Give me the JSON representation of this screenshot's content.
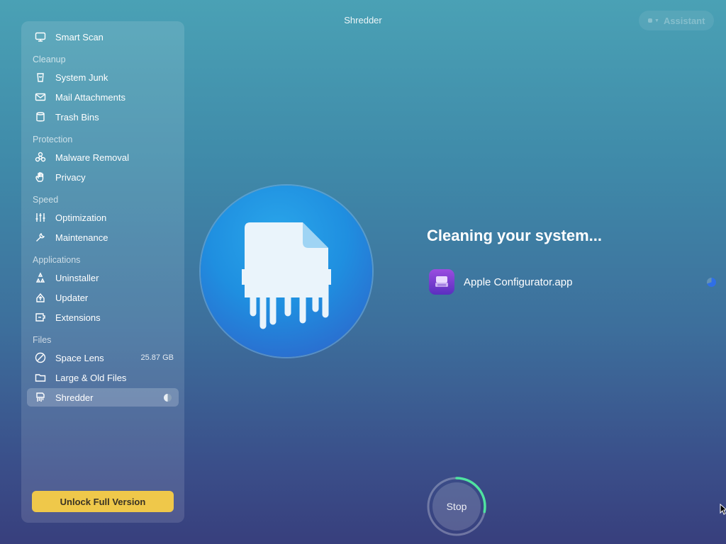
{
  "window": {
    "title": "Shredder"
  },
  "assistant": {
    "label": "Assistant"
  },
  "sidebar": {
    "top_item": {
      "label": "Smart Scan",
      "icon": "smart-scan-icon"
    },
    "sections": [
      {
        "title": "Cleanup",
        "items": [
          {
            "label": "System Junk",
            "icon": "system-junk-icon"
          },
          {
            "label": "Mail Attachments",
            "icon": "mail-icon"
          },
          {
            "label": "Trash Bins",
            "icon": "trash-icon"
          }
        ]
      },
      {
        "title": "Protection",
        "items": [
          {
            "label": "Malware Removal",
            "icon": "biohazard-icon"
          },
          {
            "label": "Privacy",
            "icon": "hand-icon"
          }
        ]
      },
      {
        "title": "Speed",
        "items": [
          {
            "label": "Optimization",
            "icon": "sliders-icon"
          },
          {
            "label": "Maintenance",
            "icon": "wrench-icon"
          }
        ]
      },
      {
        "title": "Applications",
        "items": [
          {
            "label": "Uninstaller",
            "icon": "uninstaller-icon"
          },
          {
            "label": "Updater",
            "icon": "updater-icon"
          },
          {
            "label": "Extensions",
            "icon": "extensions-icon"
          }
        ]
      },
      {
        "title": "Files",
        "items": [
          {
            "label": "Space Lens",
            "icon": "space-lens-icon",
            "meta": "25.87 GB"
          },
          {
            "label": "Large & Old Files",
            "icon": "folder-icon"
          },
          {
            "label": "Shredder",
            "icon": "shredder-icon",
            "active": true,
            "progress": 0.5
          }
        ]
      }
    ],
    "unlock_label": "Unlock Full Version"
  },
  "main": {
    "headline": "Cleaning your system...",
    "app_item": {
      "name": "Apple Configurator.app",
      "icon": "apple-configurator-icon"
    },
    "stop_label": "Stop",
    "stop_progress": 0.28
  },
  "colors": {
    "unlock_button": "#efc84a",
    "progress_ring": "#4fe3a0",
    "spinner": "#2f6fe6",
    "hero_circle": "#1f8fe0"
  }
}
